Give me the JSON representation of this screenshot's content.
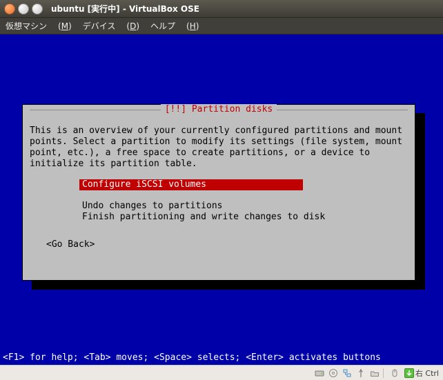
{
  "titlebar": {
    "title": "ubuntu [実行中] - VirtualBox OSE"
  },
  "menubar": {
    "machine": "仮想マシン",
    "machine_u": "M",
    "device": "デバイス",
    "device_u": "D",
    "help": "ヘルプ",
    "help_u": "H"
  },
  "dialog": {
    "title_prefix": "[!!] ",
    "title": "Partition disks",
    "overview": "This is an overview of your currently configured partitions and mount\npoints. Select a partition to modify its settings (file system, mount\npoint, etc.), a free space to create partitions, or a device to\ninitialize its partition table.",
    "options": [
      "Configure iSCSI volumes",
      "",
      "Undo changes to partitions",
      "Finish partitioning and write changes to disk"
    ],
    "selected_index": 0,
    "go_back": "<Go Back>"
  },
  "helpbar": "<F1> for help; <Tab> moves; <Space> selects; <Enter> activates buttons",
  "statusbar": {
    "host_key": "右 Ctrl"
  }
}
